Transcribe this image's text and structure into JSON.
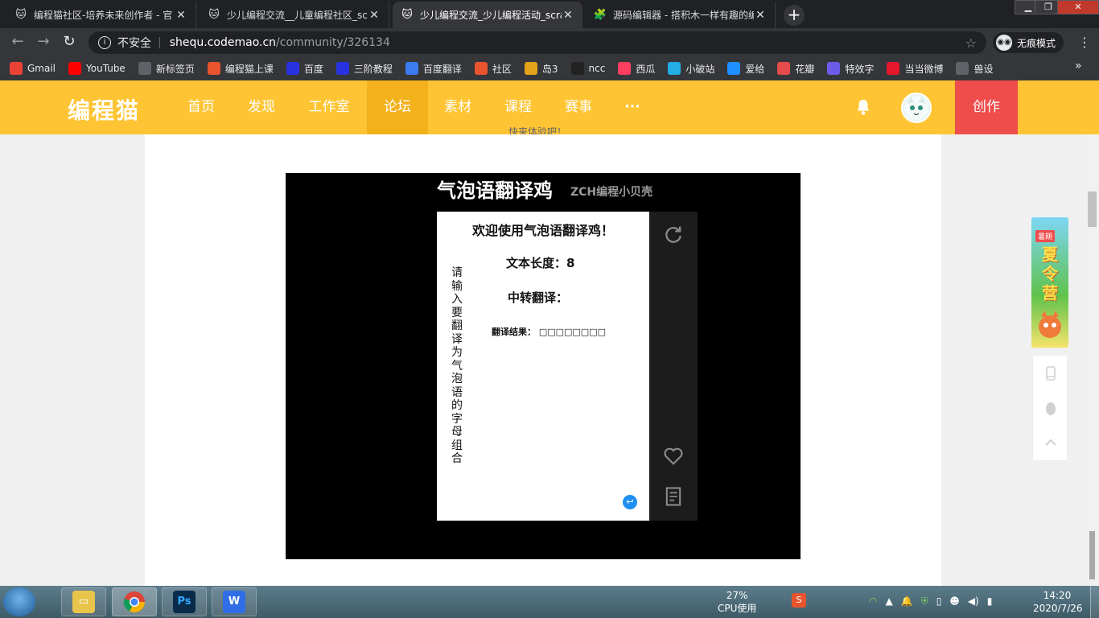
{
  "browser": {
    "tabs": [
      {
        "title": "编程猫社区-培养未来创作者 - 官",
        "active": false
      },
      {
        "title": "少儿编程交流__儿童编程社区_scr",
        "active": false
      },
      {
        "title": "少儿编程交流_少儿编程活动_scra",
        "active": true
      },
      {
        "title": "源码编辑器 - 搭积木一样有趣的编",
        "active": false
      }
    ],
    "new_tab": "+",
    "address": {
      "security_label": "不安全",
      "host": "shequ.codemao.cn",
      "path": "/community/326134"
    },
    "incognito_label": "无痕模式",
    "bookmarks": [
      {
        "label": "Gmail",
        "icon": "gmail-icon",
        "color": "#ea4335"
      },
      {
        "label": "YouTube",
        "icon": "youtube-icon",
        "color": "#ff0000"
      },
      {
        "label": "新标签页",
        "icon": "globe-icon",
        "color": "#5f6368"
      },
      {
        "label": "编程猫上课",
        "icon": "codemao-icon",
        "color": "#e8542e"
      },
      {
        "label": "百度",
        "icon": "baidu-icon",
        "color": "#2932e1"
      },
      {
        "label": "三阶教程",
        "icon": "baidu-icon",
        "color": "#2932e1"
      },
      {
        "label": "百度翻译",
        "icon": "translate-icon",
        "color": "#3a7bf0"
      },
      {
        "label": "社区",
        "icon": "codemao-icon",
        "color": "#e8542e"
      },
      {
        "label": "岛3",
        "icon": "island-icon",
        "color": "#e3a21a"
      },
      {
        "label": "ncc",
        "icon": "ncc-icon",
        "color": "#222222"
      },
      {
        "label": "西瓜",
        "icon": "xigua-icon",
        "color": "#ff3f5f"
      },
      {
        "label": "小破站",
        "icon": "bilibili-icon",
        "color": "#23ade5"
      },
      {
        "label": "爱给",
        "icon": "aigei-icon",
        "color": "#1e90ff"
      },
      {
        "label": "花瓣",
        "icon": "huaban-icon",
        "color": "#e74c4c"
      },
      {
        "label": "特效字",
        "icon": "texiaozi-icon",
        "color": "#6c5ce7"
      },
      {
        "label": "当当微博",
        "icon": "weibo-icon",
        "color": "#e6162d"
      },
      {
        "label": "兽设",
        "icon": "globe-icon",
        "color": "#5f6368"
      }
    ]
  },
  "site": {
    "logo": "编程猫",
    "nav": [
      {
        "label": "首页"
      },
      {
        "label": "发现"
      },
      {
        "label": "工作室"
      },
      {
        "label": "论坛",
        "active": true
      },
      {
        "label": "素材"
      },
      {
        "label": "课程"
      },
      {
        "label": "赛事"
      },
      {
        "label": "···"
      }
    ],
    "create_label": "创作",
    "brand_color": "#fec433",
    "create_color": "#ef4c4c"
  },
  "content": {
    "cutoff_text": "快来体验吧！",
    "work": {
      "title": "气泡语翻译鸡",
      "author": "ZCH编程小贝壳"
    },
    "stage": {
      "heading": "欢迎使用气泡语翻译鸡！",
      "length_label": "文本长度：8",
      "relay_label": "中转翻译：",
      "result_label": "翻译结果： □□□□□□□□",
      "prompt_vertical": "请输入要翻译为气泡语的字母组合"
    }
  },
  "promo": {
    "tag": "暑期",
    "text": "夏令营"
  },
  "taskbar": {
    "cpu_percent": "27%",
    "cpu_label": "CPU使用",
    "time": "14:20",
    "date": "2020/7/26"
  }
}
